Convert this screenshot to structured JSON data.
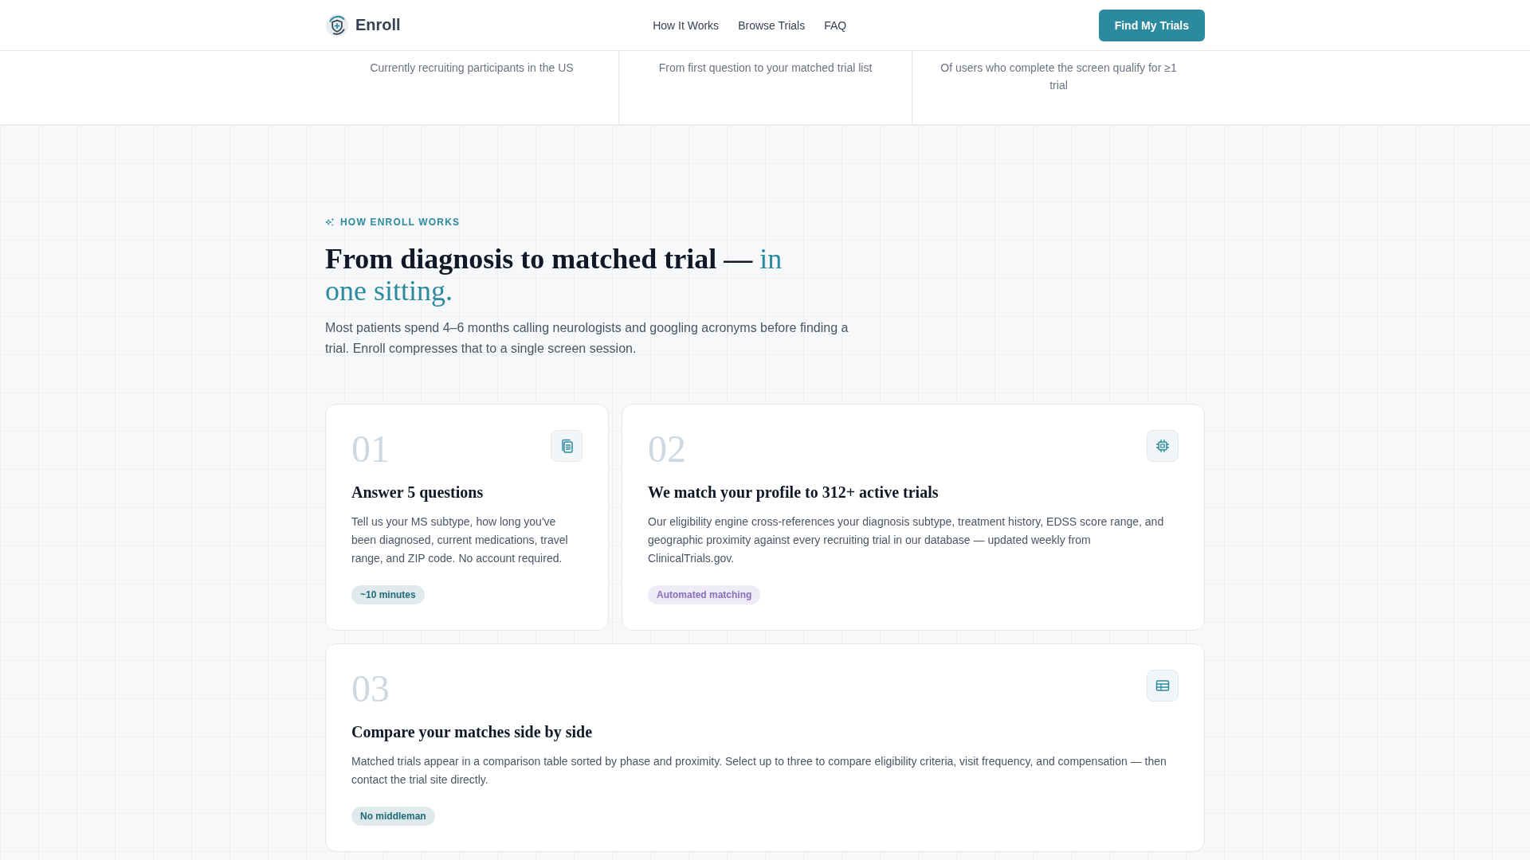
{
  "header": {
    "logo": "Enroll",
    "nav": [
      "How It Works",
      "Browse Trials",
      "FAQ"
    ],
    "cta": "Find My Trials"
  },
  "stats": [
    {
      "caption": "Currently recruiting participants in the US"
    },
    {
      "caption": "From first question to your matched trial list"
    },
    {
      "caption": "Of users who complete the screen qualify for ≥1 trial"
    }
  ],
  "how_it_works": {
    "eyebrow": "HOW ENROLL WORKS",
    "title": "**From diagnosis to matched trial —** in one sitting.",
    "intro": "Most patients spend 4–6 months calling neurologists and googling acronyms before finding a trial. Enroll compresses that to a single screen session.",
    "steps": [
      {
        "number": "01",
        "title": "Answer 5 questions",
        "description": "Tell us your MS subtype, how long you've been diagnosed, current medications, travel range, and ZIP code. No account required.",
        "tag": {
          "label": "~10 minutes",
          "color": "#1f6b78"
        }
      },
      {
        "number": "02",
        "title": "We match your profile to 312+ active trials",
        "description": "Our eligibility engine cross-references your diagnosis subtype, treatment history, EDSS score range, and geographic proximity against every recruiting trial in our database — updated weekly from ClinicalTrials.gov.",
        "tag": {
          "label": "Automated matching",
          "color": "#8a6fbf"
        }
      },
      {
        "number": "03",
        "title": "Compare your matches side by side",
        "description": "Matched trials appear in a comparison table sorted by phase and proximity. Select up to three to compare eligibility criteria, visit frequency, and compensation — then contact the trial site directly.",
        "tag": {
          "label": "No middleman",
          "color": "#1f6b78"
        }
      }
    ]
  }
}
